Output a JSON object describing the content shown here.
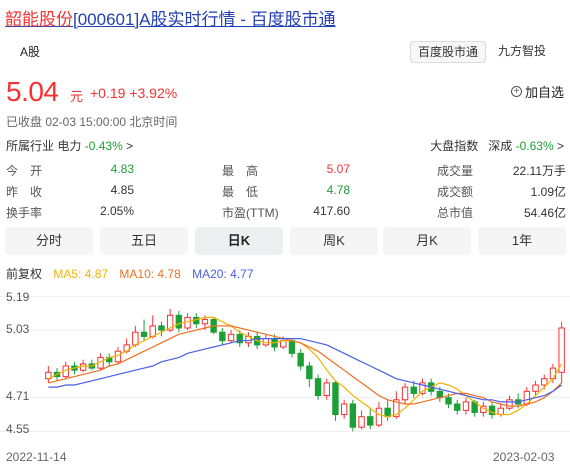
{
  "header": {
    "title_part1": "韶能股份",
    "title_part2": "[000601]A股实时行情 - 百度股市通"
  },
  "tabs": {
    "market_tab": "A股",
    "source_tags": [
      "百度股市通",
      "九方智投"
    ]
  },
  "quote": {
    "price": "5.04",
    "unit": "元",
    "change": "+0.19 +3.92%",
    "add_watchlist": "加自选",
    "status": "已收盘   02-03 15:00:00   北京时间",
    "industry_label": "所属行业",
    "industry_name": "电力",
    "industry_change": "-0.43%",
    "industry_arrow": ">",
    "market_label": "大盘指数",
    "market_name": "深成",
    "market_change": "-0.63%",
    "market_arrow": ">"
  },
  "stats": [
    [
      {
        "label": "今　开",
        "value": "4.83",
        "color": "green"
      },
      {
        "label": "最　高",
        "value": "5.07",
        "color": "red"
      },
      {
        "label": "成交量",
        "value": "22.11万手",
        "color": "normal"
      }
    ],
    [
      {
        "label": "昨　收",
        "value": "4.85",
        "color": "normal"
      },
      {
        "label": "最　低",
        "value": "4.78",
        "color": "green"
      },
      {
        "label": "成交额",
        "value": "1.09亿",
        "color": "normal"
      }
    ],
    [
      {
        "label": "换手率",
        "value": "2.05%",
        "color": "normal"
      },
      {
        "label": "市盈(TTM)",
        "value": "417.60",
        "color": "normal"
      },
      {
        "label": "总市值",
        "value": "54.46亿",
        "color": "normal"
      }
    ]
  ],
  "periods": [
    "分时",
    "五日",
    "日K",
    "周K",
    "月K",
    "1年"
  ],
  "active_period": 2,
  "legend": {
    "adjust": "前复权",
    "ma5": "MA5: 4.87",
    "ma10": "MA10: 4.78",
    "ma20": "MA20: 4.77"
  },
  "colors": {
    "up": "#f73131",
    "down": "#1ca035",
    "ma5": "#f0b400",
    "ma10": "#f07020",
    "ma20": "#4a5ee8"
  },
  "chart_data": {
    "type": "candlestick",
    "y_ticks": [
      "5.19",
      "5.03",
      "4.71",
      "4.55"
    ],
    "x_ticks": [
      "2022-11-14",
      "2023-02-03"
    ],
    "ylim": [
      4.5,
      5.22
    ],
    "series": [
      {
        "name": "MA5",
        "values": [
          4.8,
          4.82,
          4.84,
          4.85,
          4.86,
          4.86,
          4.88,
          4.9,
          4.91,
          4.93,
          4.96,
          4.98,
          5.0,
          5.02,
          5.04,
          5.06,
          5.07,
          5.08,
          5.09,
          5.09,
          5.07,
          5.05,
          5.02,
          5.0,
          4.98,
          4.97,
          4.97,
          4.98,
          4.98,
          4.97,
          4.94,
          4.9,
          4.84,
          4.79,
          4.76,
          4.72,
          4.69,
          4.66,
          4.63,
          4.62,
          4.63,
          4.66,
          4.7,
          4.74,
          4.76,
          4.78,
          4.77,
          4.75,
          4.72,
          4.69,
          4.66,
          4.64,
          4.63,
          4.63,
          4.65,
          4.68,
          4.72,
          4.76,
          4.8,
          4.87
        ]
      },
      {
        "name": "MA10",
        "values": [
          4.78,
          4.79,
          4.8,
          4.81,
          4.82,
          4.83,
          4.84,
          4.86,
          4.87,
          4.89,
          4.91,
          4.93,
          4.95,
          4.97,
          4.99,
          5.01,
          5.02,
          5.03,
          5.04,
          5.05,
          5.05,
          5.05,
          5.04,
          5.03,
          5.02,
          5.01,
          5.0,
          4.99,
          4.98,
          4.97,
          4.95,
          4.93,
          4.9,
          4.87,
          4.84,
          4.81,
          4.78,
          4.75,
          4.72,
          4.7,
          4.69,
          4.68,
          4.68,
          4.69,
          4.7,
          4.71,
          4.72,
          4.73,
          4.73,
          4.72,
          4.71,
          4.69,
          4.68,
          4.67,
          4.67,
          4.68,
          4.69,
          4.71,
          4.74,
          4.78
        ]
      },
      {
        "name": "MA20",
        "values": [
          4.76,
          4.76,
          4.77,
          4.77,
          4.78,
          4.79,
          4.8,
          4.81,
          4.82,
          4.83,
          4.84,
          4.85,
          4.86,
          4.88,
          4.89,
          4.9,
          4.92,
          4.93,
          4.94,
          4.95,
          4.96,
          4.97,
          4.98,
          4.98,
          4.99,
          4.99,
          4.99,
          4.99,
          4.99,
          4.99,
          4.98,
          4.97,
          4.96,
          4.94,
          4.92,
          4.9,
          4.88,
          4.86,
          4.84,
          4.82,
          4.8,
          4.79,
          4.78,
          4.77,
          4.76,
          4.75,
          4.74,
          4.73,
          4.72,
          4.71,
          4.7,
          4.7,
          4.69,
          4.69,
          4.69,
          4.7,
          4.71,
          4.72,
          4.74,
          4.77
        ]
      }
    ],
    "candles": [
      [
        4.8,
        4.83,
        4.86,
        4.78
      ],
      [
        4.83,
        4.81,
        4.85,
        4.79
      ],
      [
        4.81,
        4.86,
        4.88,
        4.8
      ],
      [
        4.86,
        4.84,
        4.88,
        4.82
      ],
      [
        4.84,
        4.87,
        4.89,
        4.83
      ],
      [
        4.87,
        4.85,
        4.89,
        4.84
      ],
      [
        4.85,
        4.9,
        4.92,
        4.84
      ],
      [
        4.9,
        4.88,
        4.92,
        4.86
      ],
      [
        4.88,
        4.93,
        4.95,
        4.87
      ],
      [
        4.93,
        4.96,
        4.99,
        4.92
      ],
      [
        4.96,
        5.02,
        5.05,
        4.95
      ],
      [
        5.02,
        5.0,
        5.08,
        4.98
      ],
      [
        5.0,
        5.05,
        5.1,
        4.99
      ],
      [
        5.05,
        5.03,
        5.07,
        5.0
      ],
      [
        5.03,
        5.1,
        5.13,
        5.02
      ],
      [
        5.1,
        5.04,
        5.12,
        5.02
      ],
      [
        5.04,
        5.09,
        5.11,
        5.03
      ],
      [
        5.09,
        5.06,
        5.11,
        5.04
      ],
      [
        5.06,
        5.08,
        5.1,
        5.03
      ],
      [
        5.08,
        5.02,
        5.09,
        5.01
      ],
      [
        5.02,
        4.98,
        5.04,
        4.96
      ],
      [
        4.98,
        5.01,
        5.03,
        4.97
      ],
      [
        5.01,
        4.97,
        5.03,
        4.95
      ],
      [
        4.97,
        5.0,
        5.02,
        4.95
      ],
      [
        5.0,
        4.96,
        5.02,
        4.94
      ],
      [
        4.96,
        4.99,
        5.01,
        4.95
      ],
      [
        4.99,
        4.95,
        5.01,
        4.93
      ],
      [
        4.95,
        4.98,
        5.0,
        4.94
      ],
      [
        4.98,
        4.92,
        4.99,
        4.9
      ],
      [
        4.92,
        4.86,
        4.94,
        4.84
      ],
      [
        4.86,
        4.8,
        4.88,
        4.76
      ],
      [
        4.8,
        4.72,
        4.82,
        4.7
      ],
      [
        4.72,
        4.78,
        4.8,
        4.7
      ],
      [
        4.78,
        4.63,
        4.79,
        4.6
      ],
      [
        4.63,
        4.68,
        4.7,
        4.61
      ],
      [
        4.68,
        4.57,
        4.7,
        4.55
      ],
      [
        4.57,
        4.62,
        4.65,
        4.56
      ],
      [
        4.62,
        4.58,
        4.66,
        4.56
      ],
      [
        4.58,
        4.66,
        4.69,
        4.57
      ],
      [
        4.66,
        4.62,
        4.7,
        4.6
      ],
      [
        4.62,
        4.7,
        4.74,
        4.61
      ],
      [
        4.7,
        4.76,
        4.78,
        4.68
      ],
      [
        4.76,
        4.73,
        4.79,
        4.71
      ],
      [
        4.73,
        4.78,
        4.8,
        4.72
      ],
      [
        4.78,
        4.74,
        4.8,
        4.72
      ],
      [
        4.74,
        4.71,
        4.76,
        4.69
      ],
      [
        4.71,
        4.68,
        4.73,
        4.66
      ],
      [
        4.68,
        4.65,
        4.7,
        4.63
      ],
      [
        4.65,
        4.69,
        4.71,
        4.63
      ],
      [
        4.69,
        4.64,
        4.7,
        4.62
      ],
      [
        4.64,
        4.67,
        4.69,
        4.62
      ],
      [
        4.67,
        4.63,
        4.69,
        4.61
      ],
      [
        4.63,
        4.66,
        4.68,
        4.62
      ],
      [
        4.66,
        4.7,
        4.72,
        4.65
      ],
      [
        4.7,
        4.68,
        4.73,
        4.66
      ],
      [
        4.68,
        4.74,
        4.76,
        4.67
      ],
      [
        4.74,
        4.77,
        4.79,
        4.72
      ],
      [
        4.77,
        4.8,
        4.82,
        4.75
      ],
      [
        4.8,
        4.85,
        4.87,
        4.78
      ],
      [
        4.83,
        5.04,
        5.07,
        4.78
      ]
    ]
  }
}
